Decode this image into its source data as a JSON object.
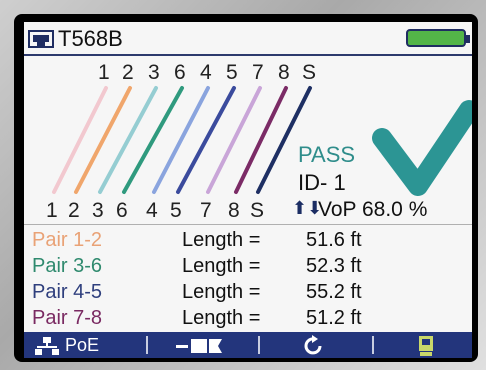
{
  "header": {
    "standard": "T568B",
    "icons": {
      "jack": "rj45-jack-icon",
      "battery": "battery-icon"
    },
    "battery_level": 1.0
  },
  "wiremap": {
    "top_pins": [
      "1",
      "2",
      "3",
      "6",
      "4",
      "5",
      "7",
      "8",
      "S"
    ],
    "bottom_pins": [
      "1",
      "2",
      "3",
      "6",
      "4",
      "5",
      "7",
      "8",
      "S"
    ],
    "wire_colors": [
      "#f2c8cf",
      "#f0a66c",
      "#95cdd2",
      "#2f9a7e",
      "#8aa4de",
      "#3b4b9d",
      "#c9a5d8",
      "#7b2b66",
      "#1e2f63"
    ],
    "status": "PASS",
    "id": "ID- 1",
    "vop": "VoP 68.0 %",
    "result_icon": "checkmark-icon",
    "result_color": "#2c9594"
  },
  "pairs": [
    {
      "name": "Pair 1-2",
      "color": "#e9a276",
      "label": "Length =",
      "value": "51.6 ft"
    },
    {
      "name": "Pair 3-6",
      "color": "#2f8a6e",
      "label": "Length =",
      "value": "52.3 ft"
    },
    {
      "name": "Pair 4-5",
      "color": "#2f3f7d",
      "label": "Length =",
      "value": "55.2 ft"
    },
    {
      "name": "Pair 7-8",
      "color": "#7a2a62",
      "label": "Length =",
      "value": "51.2 ft"
    }
  ],
  "softkeys": {
    "poe_label": "PoE",
    "icons": [
      "network-icon",
      "toner-icon",
      "refresh-icon",
      "save-icon"
    ]
  }
}
